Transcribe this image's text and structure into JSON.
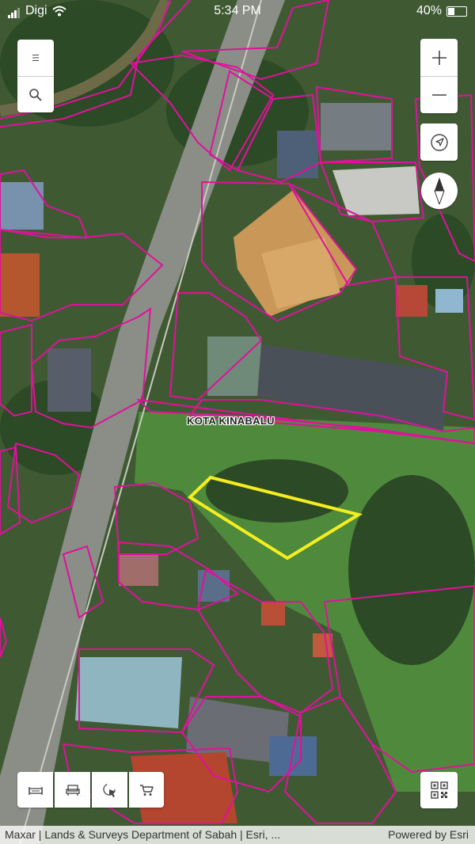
{
  "status_bar": {
    "carrier": "Digi",
    "time": "5:34 PM",
    "battery": "40%",
    "battery_level": 0.4
  },
  "map": {
    "place_label": "KOTA KINABALU"
  },
  "controls": {
    "menu_icon": "hamburger-icon",
    "search_icon": "search-icon",
    "zoom_in_icon": "plus-icon",
    "zoom_out_icon": "minus-icon",
    "locate_icon": "location-arrow-icon",
    "compass_icon": "compass-icon",
    "qr_icon": "qr-code-icon",
    "bottom_tools": [
      "bed-icon",
      "sofa-icon",
      "cursor-click-icon",
      "cart-icon"
    ]
  },
  "attribution": {
    "left": "Maxar | Lands & Surveys Department of Sabah | Esri, ...",
    "right": "Powered by Esri"
  },
  "colors": {
    "parcel_line": "#e0119d",
    "selection": "#f4ee1f",
    "vegetation": "#3c6a2c"
  }
}
